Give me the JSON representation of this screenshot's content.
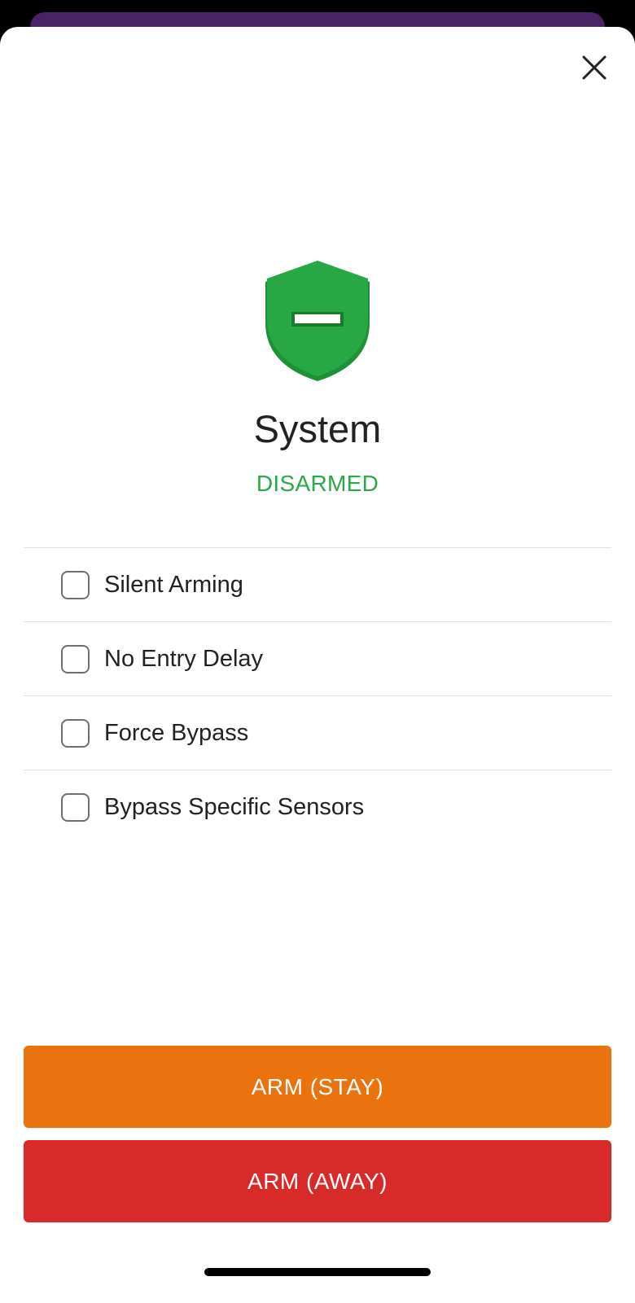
{
  "panel": {
    "title": "System",
    "status": "DISARMED"
  },
  "options": [
    {
      "label": "Silent Arming",
      "checked": false
    },
    {
      "label": "No Entry Delay",
      "checked": false
    },
    {
      "label": "Force Bypass",
      "checked": false
    },
    {
      "label": "Bypass Specific Sensors",
      "checked": false
    }
  ],
  "actions": {
    "arm_stay_label": "ARM (STAY)",
    "arm_away_label": "ARM (AWAY)"
  },
  "colors": {
    "status_green": "#2aaa45",
    "shield_green": "#28a745",
    "arm_stay": "#ea720f",
    "arm_away": "#d92a2a",
    "backdrop_purple": "#4a2266"
  },
  "icons": {
    "close": "close-icon",
    "shield": "shield-disarmed-icon"
  }
}
